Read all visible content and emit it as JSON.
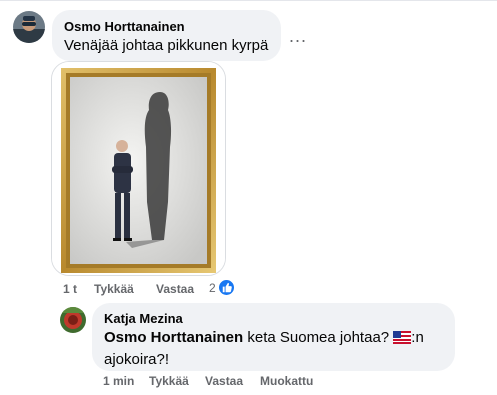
{
  "comment1": {
    "author": "Osmo Horttanainen",
    "text": "Venäjää johtaa pikkunen kyrpä",
    "more_options": "...",
    "time": "1 t",
    "like_label": "Tykkää",
    "reply_label": "Vastaa",
    "reaction_count": "2",
    "reaction_icon": "thumbs-up-icon",
    "image_icon": "framed-man-shadow-image"
  },
  "reply1": {
    "author": "Katja Mezina",
    "mention": "Osmo Horttanainen",
    "text_before_flag": " keta Suomea johtaa? ",
    "flag_icon": "us-flag-icon",
    "text_after_flag_line1": ":n",
    "text_line2": "ajokoira?!",
    "time": "1 min",
    "like_label": "Tykkää",
    "reply_label": "Vastaa",
    "edited_label": "Muokattu"
  },
  "colors": {
    "bubble": "#f0f2f5",
    "meta_text": "#65676b",
    "like_blue": "#1877f2",
    "frame_gold": "#c9a146"
  }
}
